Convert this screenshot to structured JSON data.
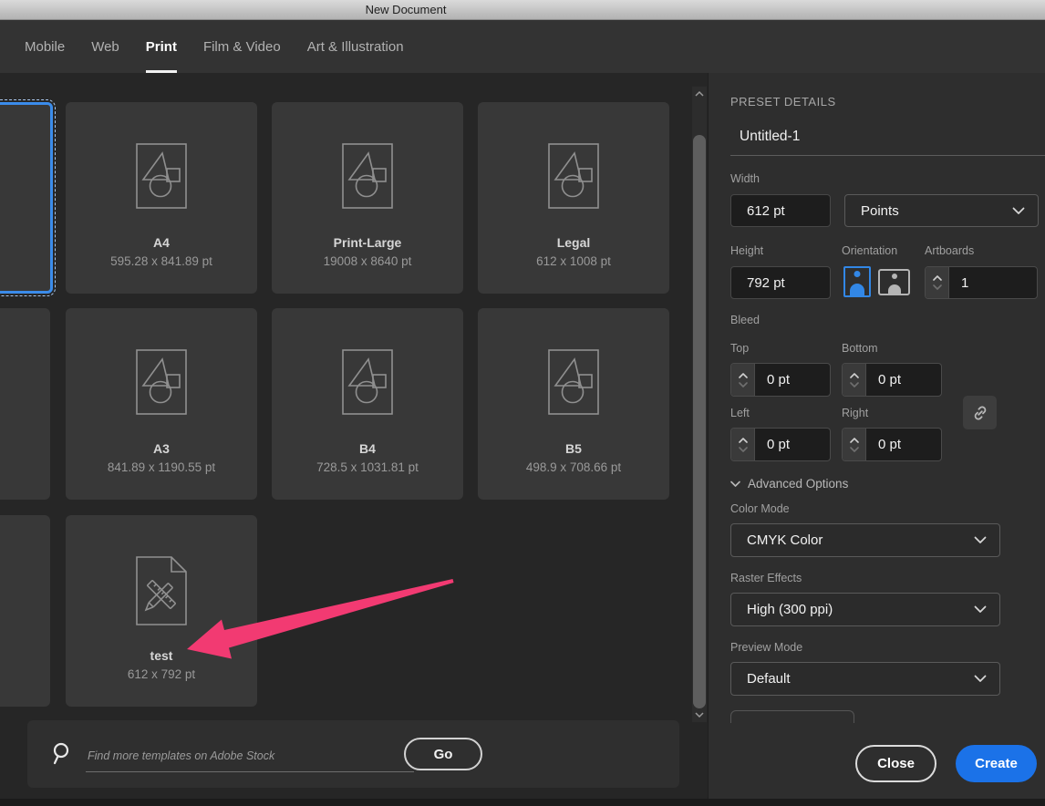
{
  "window": {
    "title": "New Document"
  },
  "tabs": [
    {
      "label": "Mobile",
      "active": false
    },
    {
      "label": "Web",
      "active": false
    },
    {
      "label": "Print",
      "active": true
    },
    {
      "label": "Film & Video",
      "active": false
    },
    {
      "label": "Art & Illustration",
      "active": false
    }
  ],
  "templates": [
    {
      "name": "A4",
      "size": "595.28 x 841.89 pt"
    },
    {
      "name": "Print-Large",
      "size": "19008 x 8640 pt"
    },
    {
      "name": "Legal",
      "size": "612 x 1008 pt"
    },
    {
      "name": "A3",
      "size": "841.89 x 1190.55 pt"
    },
    {
      "name": "B4",
      "size": "728.5 x 1031.81 pt"
    },
    {
      "name": "B5",
      "size": "498.9 x 708.66 pt"
    },
    {
      "name": "test",
      "size": "612 x 792 pt"
    }
  ],
  "search": {
    "placeholder": "Find more templates on Adobe Stock",
    "go_label": "Go"
  },
  "preset": {
    "header": "PRESET DETAILS",
    "name": "Untitled-1",
    "width_label": "Width",
    "width_value": "612 pt",
    "units_value": "Points",
    "height_label": "Height",
    "height_value": "792 pt",
    "orientation_label": "Orientation",
    "artboards_label": "Artboards",
    "artboards_value": "1",
    "bleed_label": "Bleed",
    "bleed": {
      "top_label": "Top",
      "top_value": "0 pt",
      "bottom_label": "Bottom",
      "bottom_value": "0 pt",
      "left_label": "Left",
      "left_value": "0 pt",
      "right_label": "Right",
      "right_value": "0 pt"
    },
    "advanced_label": "Advanced Options",
    "color_mode_label": "Color Mode",
    "color_mode_value": "CMYK Color",
    "raster_label": "Raster Effects",
    "raster_value": "High (300 ppi)",
    "preview_label": "Preview Mode",
    "preview_value": "Default"
  },
  "footer": {
    "close_label": "Close",
    "create_label": "Create"
  },
  "icons": {
    "search": "magnifier",
    "bleed_link": "chain-link",
    "orientation_portrait": "portrait-person",
    "orientation_landscape": "landscape-person",
    "template_standard": "shapes-on-artboard",
    "template_custom": "pencil-ruler-document",
    "dropdown": "chevron-down",
    "annotation": "pink-arrow"
  },
  "colors": {
    "accent_blue": "#1b72e8",
    "selection_blue": "#3b8ceb",
    "orientation_blue": "#3287e6",
    "annotation_pink": "#f23a72"
  }
}
